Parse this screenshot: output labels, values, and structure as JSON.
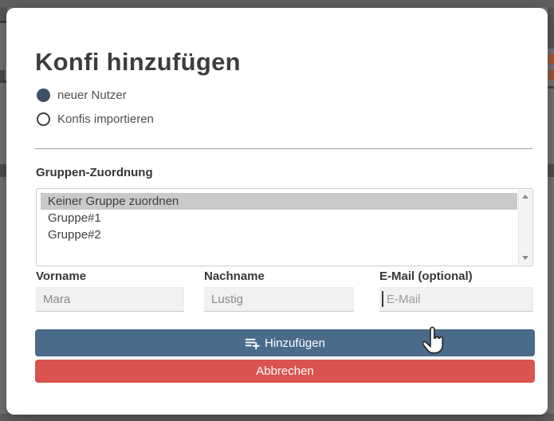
{
  "modal": {
    "title": "Konfi hinzufügen",
    "radio_options": [
      {
        "label": "neuer Nutzer",
        "selected": true
      },
      {
        "label": "Konfis importieren",
        "selected": false
      }
    ],
    "group_section": {
      "label": "Gruppen-Zuordnung",
      "options": [
        "Keiner Gruppe zuordnen",
        "Gruppe#1",
        "Gruppe#2"
      ],
      "selected_option": "Keiner Gruppe zuordnen"
    },
    "fields": [
      {
        "label": "Vorname",
        "value": "Mara",
        "placeholder": ""
      },
      {
        "label": "Nachname",
        "value": "Lustig",
        "placeholder": ""
      },
      {
        "label": "E-Mail (optional)",
        "value": "",
        "placeholder": "E-Mail"
      }
    ],
    "buttons": [
      {
        "label": "Hinzufügen",
        "icon": "playlist-add-icon",
        "color": "#4a6b8a"
      },
      {
        "label": "Abbrechen",
        "color": "#d9534f"
      }
    ]
  },
  "colors": {
    "radio_selected": "#3d5266",
    "list_selected_bg": "#c9c9c9",
    "overlay": "#737373"
  },
  "cursor": {
    "type": "hand-pointer"
  }
}
